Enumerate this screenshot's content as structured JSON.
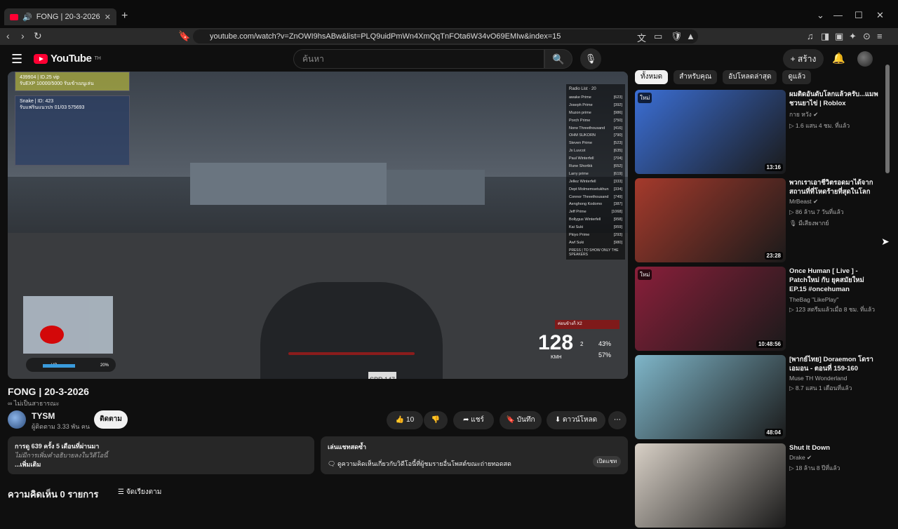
{
  "browser": {
    "tab_title": "FONG | 20-3-2026 - YouTube",
    "tab_close": "✕",
    "new_tab": "+",
    "url": "youtube.com/watch?v=ZnOWI9hsABw&list=PLQ9uidPmWn4XmQqTnFOta6W34vO69EMIw&index=15",
    "controls": {
      "dropdown": "⌄",
      "minimize": "—",
      "maximize": "☐",
      "close": "✕"
    }
  },
  "youtube": {
    "logo_text": "YouTube",
    "logo_region": "TH",
    "search_placeholder": "ค้นหา",
    "create_label": "+ สร้าง"
  },
  "player": {
    "hud": {
      "panel1_line1": "439904 | ID.25  vip",
      "panel1_line2": "รับEXP 10000/5000 รับเข้าเมนูเล่น",
      "panel2_line1": "Snake | ID: 423",
      "panel2_line2": "รับแฟรินแนวปร 01/03 575693",
      "radio_title": "Radio List",
      "radio_count": "20",
      "radio_rows": [
        {
          "name": "awake Prime",
          "val": "[623]"
        },
        {
          "name": "Joseph Prime",
          "val": "[392]"
        },
        {
          "name": "Muzon prime",
          "val": "[986]"
        },
        {
          "name": "Porch Prime",
          "val": "[750]"
        },
        {
          "name": "Norw Threethousand",
          "val": "[416]"
        },
        {
          "name": "OHM SUKORN",
          "val": "[790]"
        },
        {
          "name": "Steven Prime",
          "val": "[523]"
        },
        {
          "name": "Jx Luvcot",
          "val": "[635]"
        },
        {
          "name": "Paul Winterfell",
          "val": "[704]"
        },
        {
          "name": "Rune Shortkk",
          "val": "[652]"
        },
        {
          "name": "Larry prime",
          "val": "[619]"
        },
        {
          "name": "Jellez Winterfell",
          "val": "[333]"
        },
        {
          "name": "Dept Molmemsetukhun",
          "val": "[334]"
        },
        {
          "name": "Connor Threethousand",
          "val": "[749]"
        },
        {
          "name": "Aenghong Kodomo",
          "val": "[387]"
        },
        {
          "name": "Jeff Prime",
          "val": "[1068]"
        },
        {
          "name": "Bollygus Winterfell",
          "val": "[958]"
        },
        {
          "name": "Kai Suki",
          "val": "[959]"
        },
        {
          "name": "Pkiyo Prime",
          "val": "[293]"
        },
        {
          "name": "Awf Suki",
          "val": "[980]"
        }
      ],
      "radio_footer": "PRESS | TO SHOW ONLY THE SPEAKERS",
      "speed": "128",
      "speed_unit": "KMH",
      "fuel_pct": "43%",
      "engine_pct": "57%",
      "gear": "2",
      "plate": "SPR 147",
      "hp_label": "HP",
      "hp_pct": "20%",
      "hp_fill": 0.6,
      "wanted_label": "ค่อนข้างก็ X2"
    }
  },
  "video": {
    "title": "FONG | 20-3-2026",
    "privacy": "∞ ไม่เป็นสาธารณะ",
    "channel_name": "TYSM",
    "subscribers": "ผู้ติดตาม 3.33 พัน คน",
    "subscribe_label": "ติดตาม",
    "like_count": "10",
    "share_label": "แชร์",
    "save_label": "บันทึก",
    "download_label": "ดาวน์โหลด",
    "more_label": "⋯"
  },
  "description": {
    "views_line": "การดู 639 ครั้ง  5 เดือนที่ผ่านมา",
    "no_desc": "ไม่มีการเพิ่มคำอธิบายลงในวิดีโอนี้",
    "more": "...เพิ่มเติม"
  },
  "chat_replay": {
    "title": "เล่นแชทสดซ้ำ",
    "text": "ดูความคิดเห็นเกี่ยวกับวิดีโอนี้ที่ผู้ชมรายอื่นโพสต์ขณะถ่ายทอดสด",
    "open_label": "เปิดแชท"
  },
  "comments": {
    "count_label": "ความคิดเห็น 0 รายการ",
    "sort_label": "จัดเรียงตาม"
  },
  "sidebar": {
    "chips": [
      "ทั้งหมด",
      "สำหรับคุณ",
      "อัปโหลดล่าสุด",
      "ดูแล้ว"
    ],
    "videos": [
      {
        "title": "ผมติดอันดับโลกแล้วครับ...แมพชวนยาไข่ | Roblox",
        "channel": "กาย หวัง ✔",
        "views": "▷ 1.6 แสน  4 ชม. ที่แล้ว",
        "extra": "",
        "duration": "13:16",
        "badge": "ใหม่",
        "thumb": "#3b6fd6"
      },
      {
        "title": "พวกเราเอาชีวิตรอดมาได้จากสถานที่ที่โหดร้ายที่สุดในโลก",
        "channel": "MrBeast ✔",
        "views": "▷ 86 ล้าน  7 วันที่แล้ว",
        "extra": "🎙 มีเสียงพากย์",
        "duration": "23:28",
        "badge": "",
        "thumb": "#a53a2c"
      },
      {
        "title": "Once Human [ Live ] - Patchใหม่ กับ ยุคสมัยใหม่ EP.15 #oncehuman #noping...",
        "channel": "TheBag \"LikePlay\"",
        "views": "▷ 123  สตรีมแล้วเมื่อ 8 ชม. ที่แล้ว",
        "extra": "",
        "duration": "10:48:56",
        "badge": "ใหม่",
        "thumb": "#8a1f3a"
      },
      {
        "title": "[พากย์ไทย] Doraemon โดราเอมอน - ตอนที่ 159-160",
        "channel": "Muse TH Wonderland",
        "views": "▷ 8.7 แสน  1 เดือนที่แล้ว",
        "extra": "",
        "duration": "48:04",
        "badge": "",
        "thumb": "#7fb6c9"
      },
      {
        "title": "Shut It Down",
        "channel": "Drake ✔",
        "views": "▷ 18 ล้าน  8 ปีที่แล้ว",
        "extra": "",
        "duration": "",
        "badge": "",
        "thumb": "#d8d0c6"
      }
    ]
  }
}
